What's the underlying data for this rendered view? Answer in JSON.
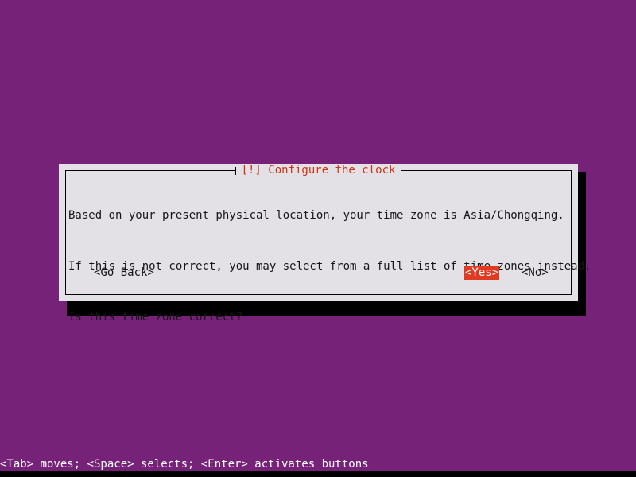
{
  "screen": {
    "background_color": "#762278",
    "bottom_strip_color": "#000000"
  },
  "dialog": {
    "title": "[!] Configure the clock",
    "title_color": "#cc3311",
    "background_color": "#e4e1e6",
    "border_color": "#000000",
    "shadow_color": "#000000",
    "body_lines": [
      "Based on your present physical location, your time zone is Asia/Chongqing.",
      "If this is not correct, you may select from a full list of time zones instead.",
      "Is this time zone correct?"
    ],
    "buttons": {
      "go_back": "<Go Back>",
      "yes": "<Yes>",
      "no": "<No>",
      "selected": "<Yes>",
      "highlight_background": "#e03a22",
      "highlight_text_color": "#ffffff"
    }
  },
  "status_bar": {
    "text": "<Tab> moves; <Space> selects; <Enter> activates buttons",
    "text_color": "#ffffff"
  }
}
